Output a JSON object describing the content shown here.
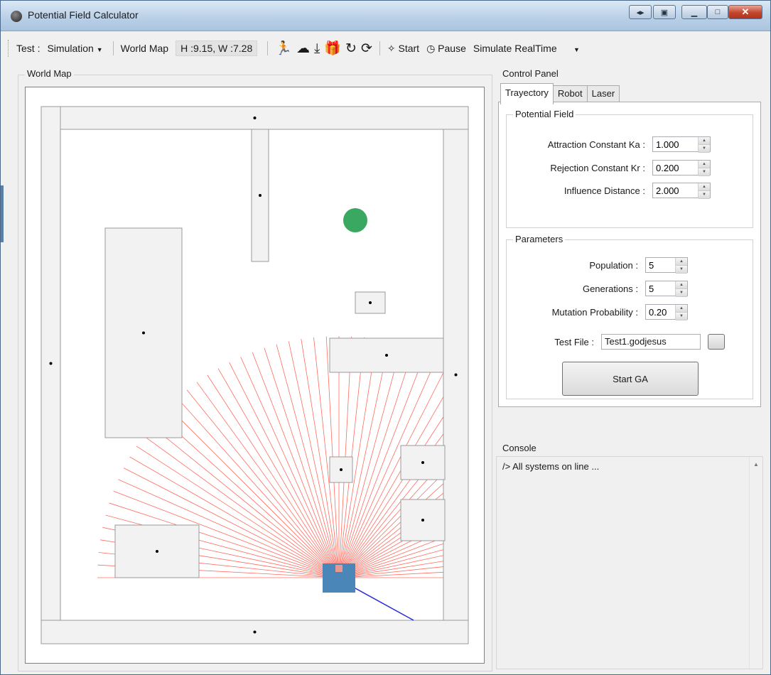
{
  "window": {
    "title": "Potential Field Calculator"
  },
  "toolbar": {
    "test_label": "Test :",
    "test_value": "Simulation",
    "world_map_label": "World Map",
    "dimensions": "H :9.15, W :7.28",
    "start_label": "Start",
    "pause_label": "Pause",
    "sim_mode": "Simulate RealTime"
  },
  "world_map": {
    "label": "World Map",
    "colors": {
      "obstacle_fill": "#f2f2f2",
      "obstacle_stroke": "#999999",
      "goal": "#3aa860",
      "robot": "#4a86b8",
      "laser": "#ff6b5e",
      "path": "#2a2ae0"
    }
  },
  "control_panel": {
    "label": "Control Panel",
    "tabs": [
      "Trayectory",
      "Robot",
      "Laser"
    ],
    "potential_field": {
      "label": "Potential Field",
      "fields": [
        {
          "label": "Attraction Constant Ka :",
          "value": "1.000"
        },
        {
          "label": "Rejection Constant Kr :",
          "value": "0.200"
        },
        {
          "label": "Influence Distance :",
          "value": "2.000"
        }
      ]
    },
    "parameters": {
      "label": "Parameters",
      "fields": [
        {
          "label": "Population :",
          "value": "5"
        },
        {
          "label": "Generations :",
          "value": "5"
        },
        {
          "label": "Mutation Probability :",
          "value": "0.20"
        }
      ],
      "test_file_label": "Test File :",
      "test_file_value": "Test1.godjesus"
    },
    "start_ga": "Start GA"
  },
  "console": {
    "label": "Console",
    "text": "/> All systems on line ..."
  }
}
